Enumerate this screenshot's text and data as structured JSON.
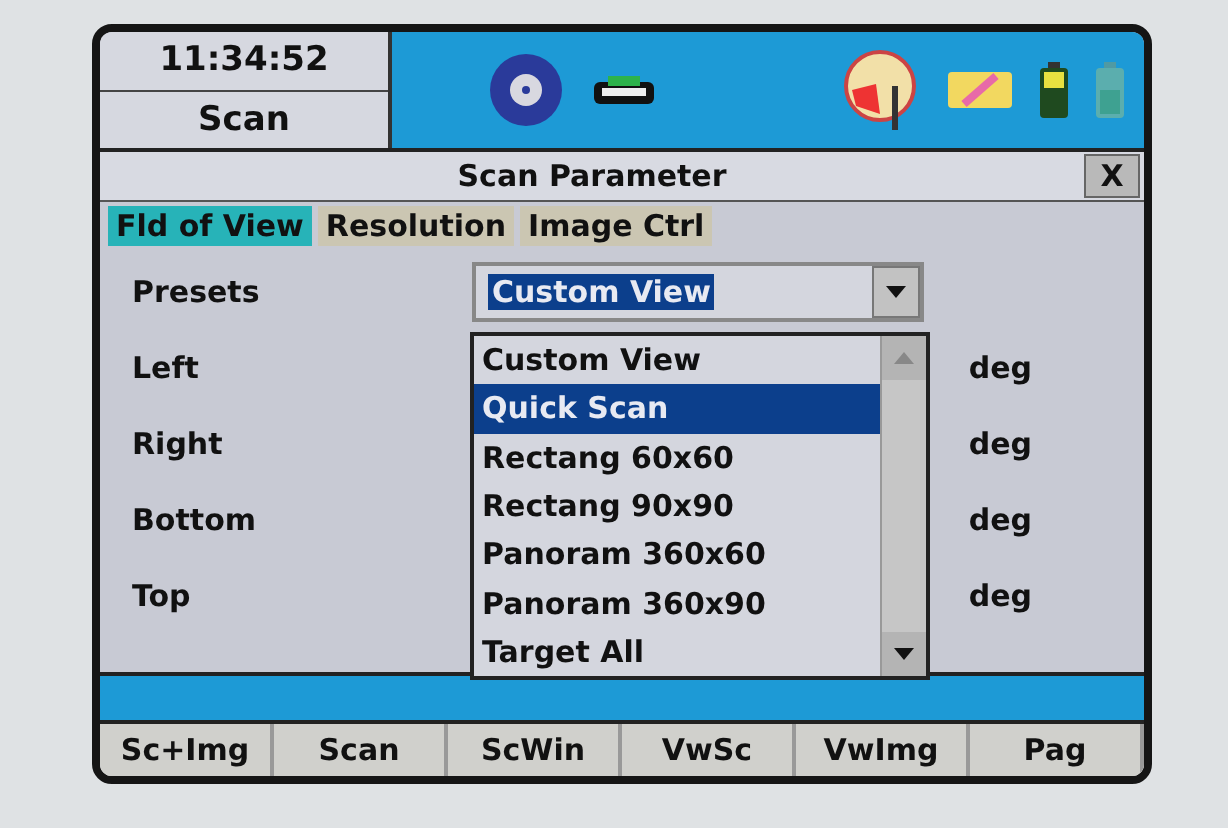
{
  "header": {
    "time": "11:34:52",
    "mode": "Scan"
  },
  "dialog": {
    "title": "Scan Parameter",
    "close": "X"
  },
  "tabs": [
    {
      "label": "Fld of View",
      "selected": true
    },
    {
      "label": "Resolution",
      "selected": false
    },
    {
      "label": "Image Ctrl",
      "selected": false
    }
  ],
  "presets": {
    "label": "Presets",
    "value": "Custom View"
  },
  "fields": [
    {
      "label": "Left",
      "unit": "deg"
    },
    {
      "label": "Right",
      "unit": "deg"
    },
    {
      "label": "Bottom",
      "unit": "deg"
    },
    {
      "label": "Top",
      "unit": "deg"
    }
  ],
  "dropdown": {
    "options": [
      {
        "label": "Custom View",
        "selected": false
      },
      {
        "label": "Quick Scan",
        "selected": true
      },
      {
        "label": "Rectang 60x60",
        "selected": false
      },
      {
        "label": "Rectang 90x90",
        "selected": false
      },
      {
        "label": "Panoram 360x60",
        "selected": false
      },
      {
        "label": "Panoram 360x90",
        "selected": false
      },
      {
        "label": "Target All",
        "selected": false
      }
    ]
  },
  "softkeys": [
    "Sc+Img",
    "Scan",
    "ScWin",
    "VwSc",
    "VwImg",
    "Pag"
  ]
}
